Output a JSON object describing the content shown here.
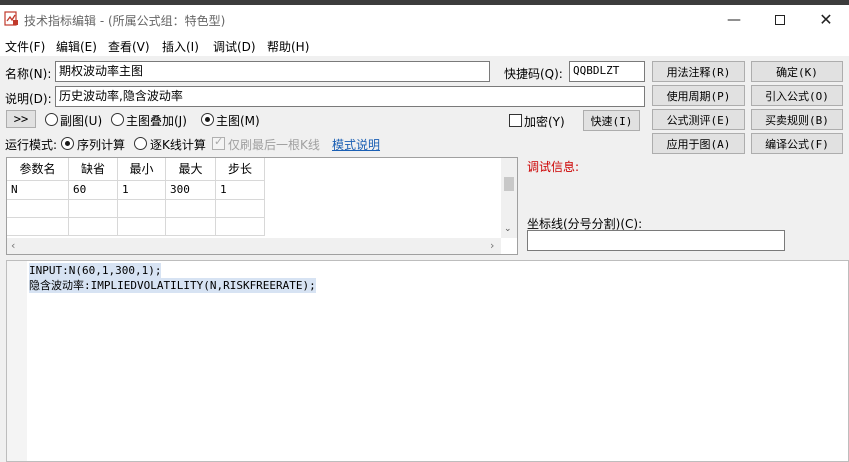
{
  "window": {
    "title": "技术指标编辑 - (所属公式组：特色型)",
    "minimize_icon": "minimize-icon",
    "maximize_icon": "maximize-icon",
    "close_icon": "close-icon"
  },
  "menu": {
    "items": [
      "文件(F)",
      "编辑(E)",
      "查看(V)",
      "插入(I)",
      "调试(D)",
      "帮助(H)"
    ]
  },
  "form": {
    "name_label": "名称(N):",
    "name_value": "期权波动率主图",
    "shortcut_label": "快捷码(Q):",
    "shortcut_value": "QQBDLZT",
    "desc_label": "说明(D):",
    "desc_value": "历史波动率,隐含波动率",
    "expand_button": ">>",
    "radio_sub": "副图(U)",
    "radio_overlay": "主图叠加(J)",
    "radio_main": "主图(M)",
    "encrypt_label": "加密(Y)",
    "run_mode_label": "运行模式:",
    "run_seq": "序列计算",
    "run_step": "逐K线计算",
    "refresh_last": "仅刷最后一根K线",
    "mode_help_link": "模式说明"
  },
  "buttons": {
    "usage_note": "用法注释(R)",
    "confirm": "确定(K)",
    "use_period": "使用周期(P)",
    "import_formula": "引入公式(O)",
    "quick": "快速(I)",
    "formula_eval": "公式测评(E)",
    "trade_rules": "买卖规则(B)",
    "apply_chart": "应用于图(A)",
    "compile": "编译公式(F)"
  },
  "params": {
    "headers": [
      "参数名",
      "缺省",
      "最小",
      "最大",
      "步长"
    ],
    "rows": [
      [
        "N",
        "60",
        "1",
        "300",
        "1"
      ]
    ]
  },
  "debug": {
    "label": "调试信息:",
    "color": "#cc0000"
  },
  "axis": {
    "label": "坐标线(分号分割)(C):",
    "value": ""
  },
  "code": {
    "lines": [
      "INPUT:N(60,1,300,1);",
      "隐含波动率:IMPLIEDVOLATILITY(N,RISKFREERATE);"
    ]
  }
}
